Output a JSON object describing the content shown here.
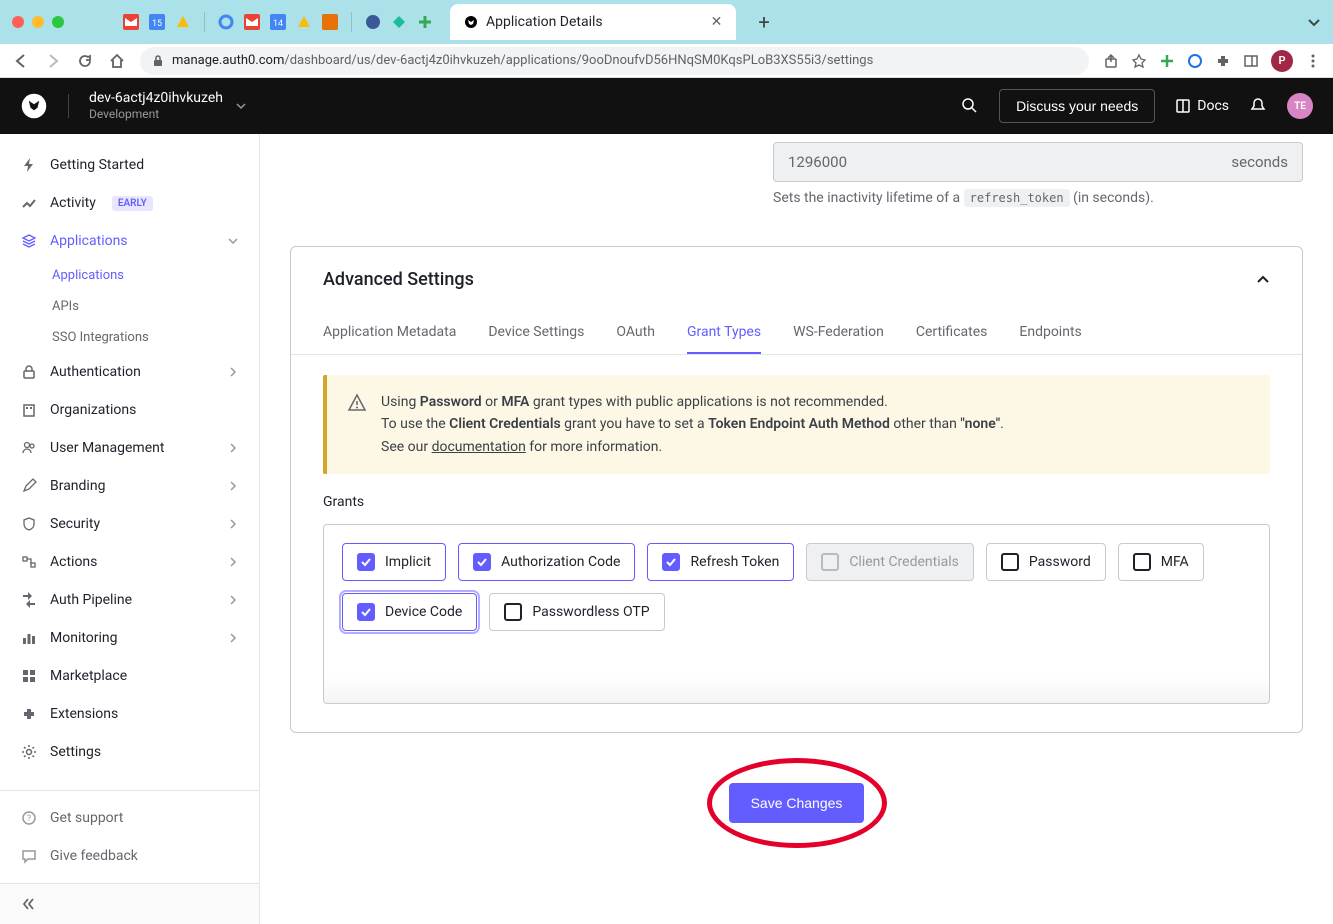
{
  "browser": {
    "tab_title": "Application Details",
    "url_host": "manage.auth0.com",
    "url_path": "/dashboard/us/dev-6actj4z0ihvkuzeh/applications/9ooDnoufvD56HNqSM0KqsPLoB3XS55i3/settings",
    "avatar_letter": "P"
  },
  "header": {
    "tenant": "dev-6actj4z0ihvkuzeh",
    "environment": "Development",
    "discuss": "Discuss your needs",
    "docs": "Docs",
    "avatar": "TE"
  },
  "sidebar": {
    "getting_started": "Getting Started",
    "activity": "Activity",
    "activity_badge": "EARLY",
    "applications": "Applications",
    "applications_sub": "Applications",
    "apis": "APIs",
    "sso": "SSO Integrations",
    "authentication": "Authentication",
    "organizations": "Organizations",
    "user_management": "User Management",
    "branding": "Branding",
    "security": "Security",
    "actions": "Actions",
    "auth_pipeline": "Auth Pipeline",
    "monitoring": "Monitoring",
    "marketplace": "Marketplace",
    "extensions": "Extensions",
    "settings": "Settings",
    "get_support": "Get support",
    "give_feedback": "Give feedback"
  },
  "lifetime": {
    "value": "1296000",
    "unit": "seconds",
    "help_prefix": "Sets the inactivity lifetime of a ",
    "help_code": "refresh_token",
    "help_suffix": " (in seconds)."
  },
  "advanced": {
    "title": "Advanced Settings",
    "tabs": {
      "app_metadata": "Application Metadata",
      "device_settings": "Device Settings",
      "oauth": "OAuth",
      "grant_types": "Grant Types",
      "ws_federation": "WS-Federation",
      "certificates": "Certificates",
      "endpoints": "Endpoints"
    },
    "warning": {
      "line1_a": "Using ",
      "line1_b": "Password",
      "line1_c": " or ",
      "line1_d": "MFA",
      "line1_e": " grant types with public applications is not recommended.",
      "line2_a": "To use the ",
      "line2_b": "Client Credentials",
      "line2_c": " grant you have to set a ",
      "line2_d": "Token Endpoint Auth Method",
      "line2_e": " other than ",
      "line2_f": "\"none\"",
      "line2_g": ".",
      "line3_a": "See our ",
      "line3_link": "documentation",
      "line3_b": " for more information."
    },
    "grants_label": "Grants",
    "grants": {
      "implicit": "Implicit",
      "authorization_code": "Authorization Code",
      "refresh_token": "Refresh Token",
      "client_credentials": "Client Credentials",
      "password": "Password",
      "mfa": "MFA",
      "device_code": "Device Code",
      "passwordless_otp": "Passwordless OTP"
    }
  },
  "save_button": "Save Changes"
}
